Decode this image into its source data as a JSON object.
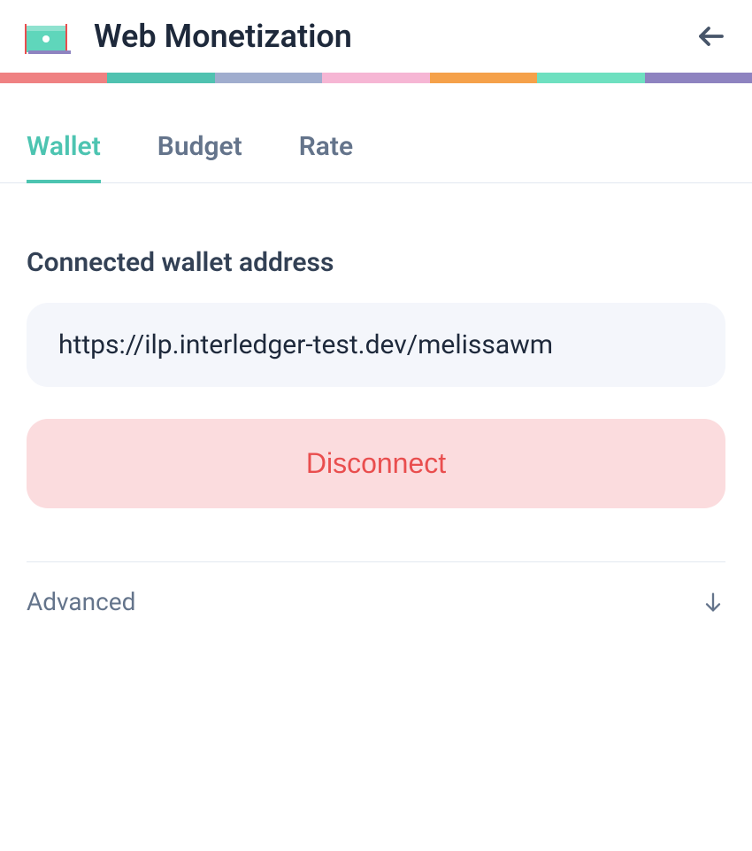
{
  "header": {
    "title": "Web Monetization"
  },
  "tabs": [
    {
      "label": "Wallet",
      "active": true
    },
    {
      "label": "Budget",
      "active": false
    },
    {
      "label": "Rate",
      "active": false
    }
  ],
  "wallet": {
    "section_label": "Connected wallet address",
    "address": "https://ilp.interledger-test.dev/melissawm",
    "disconnect_label": "Disconnect"
  },
  "advanced": {
    "label": "Advanced"
  },
  "colors": {
    "accent": "#4dc4b1",
    "danger": "#e94e4e",
    "danger_bg": "#fbdcde"
  }
}
